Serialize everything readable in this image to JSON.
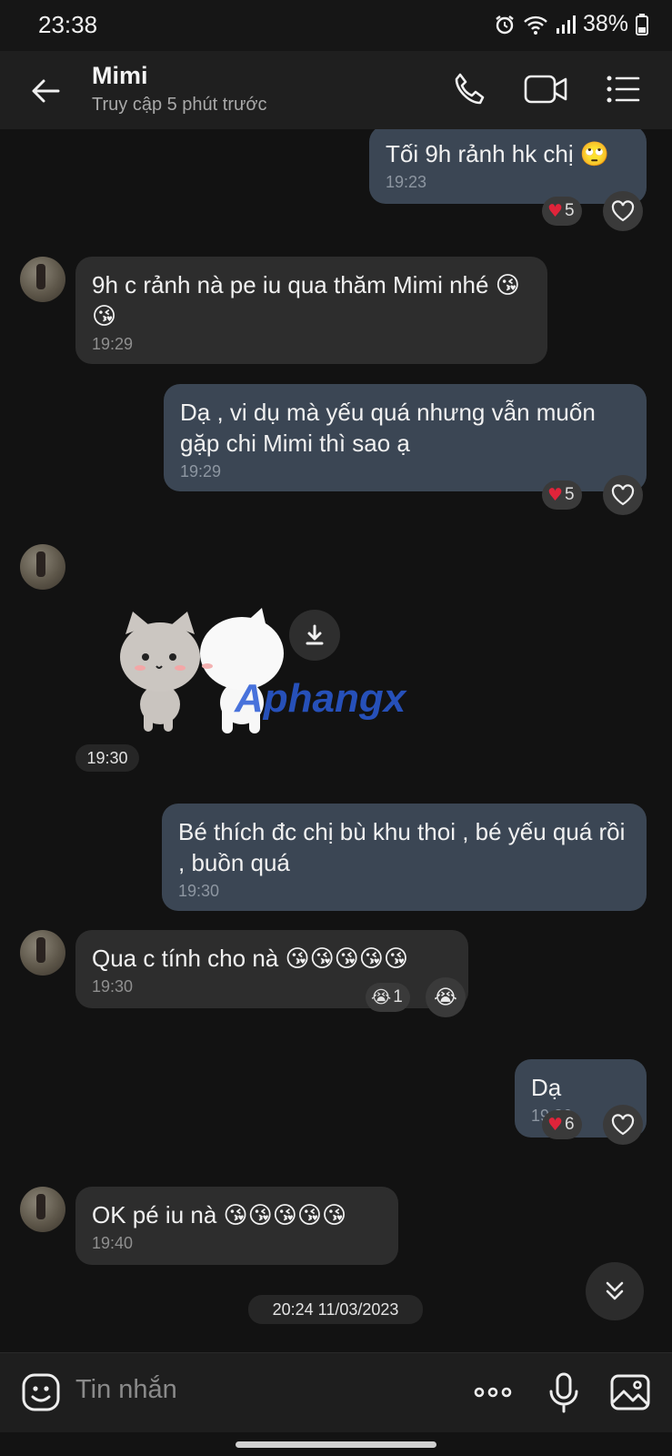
{
  "status_bar": {
    "time": "23:38",
    "battery": "38%"
  },
  "header": {
    "name": "Mimi",
    "subtitle": "Truy cập 5 phút trước"
  },
  "messages": [
    {
      "dir": "out",
      "text": "Tối 9h rảnh hk chị 🙄",
      "time": "19:23",
      "reaction": {
        "emoji": "❤️",
        "count": "5"
      }
    },
    {
      "dir": "in",
      "text": "9h c rảnh nà pe iu qua thăm Mimi nhé 😘😘",
      "time": "19:29"
    },
    {
      "dir": "out",
      "text": "Dạ , vi dụ mà yếu quá nhưng vẫn muốn gặp chi Mimi thì sao ạ",
      "time": "19:29",
      "reaction": {
        "emoji": "❤️",
        "count": "5"
      }
    },
    {
      "dir": "in",
      "type": "sticker",
      "time": "19:30",
      "watermark": "Aphangx"
    },
    {
      "dir": "out",
      "text": "Bé thích đc chị bù khu thoi , bé yếu quá rồi , buồn quá",
      "time": "19:30"
    },
    {
      "dir": "in",
      "text": "Qua c tính cho nà 😘😘😘😘😘",
      "time": "19:30",
      "reaction": {
        "emoji": "😭",
        "count": "1"
      }
    },
    {
      "dir": "out",
      "text": "Dạ",
      "time": "19:36",
      "reaction": {
        "emoji": "❤️",
        "count": "6"
      }
    },
    {
      "dir": "in",
      "text": "OK pé iu nà 😘😘😘😘😘",
      "time": "19:40"
    }
  ],
  "date_separator": "20:24 11/03/2023",
  "input": {
    "placeholder": "Tin nhắn"
  },
  "icons": {
    "back": "arrow-left-icon",
    "call": "phone-icon",
    "video": "video-icon",
    "menu": "list-icon",
    "sticker": "smiley-icon",
    "more": "ellipsis-icon",
    "mic": "microphone-icon",
    "gallery": "image-icon",
    "download": "download-icon",
    "scroll_down": "double-chevron-down-icon",
    "react": "heart-outline-icon"
  },
  "colors": {
    "bubble_out": "#3b4654",
    "bubble_in": "#2d2d2d",
    "background": "#121212",
    "heart": "#e0243a"
  }
}
